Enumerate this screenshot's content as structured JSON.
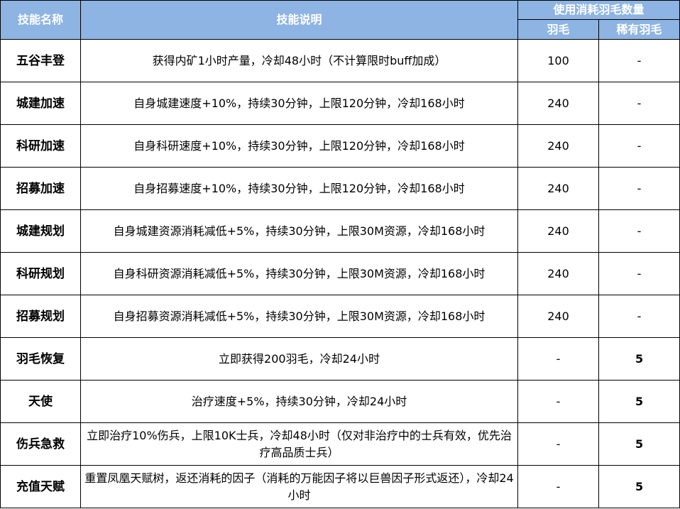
{
  "header": {
    "col_name": "技能名称",
    "col_desc": "技能说明",
    "col_cost_group": "使用消耗羽毛数量",
    "col_feather": "羽毛",
    "col_rare_feather": "稀有羽毛"
  },
  "rows": [
    {
      "name": "五谷丰登",
      "desc": "获得内矿1小时产量，冷却48小时（不计算限时buff加成）",
      "feather": "100",
      "rare": "-"
    },
    {
      "name": "城建加速",
      "desc": "自身城建速度+10%，持续30分钟，上限120分钟，冷却168小时",
      "feather": "240",
      "rare": "-"
    },
    {
      "name": "科研加速",
      "desc": "自身科研速度+10%，持续30分钟，上限120分钟，冷却168小时",
      "feather": "240",
      "rare": "-"
    },
    {
      "name": "招募加速",
      "desc": "自身招募速度+10%，持续30分钟，上限120分钟，冷却168小时",
      "feather": "240",
      "rare": "-"
    },
    {
      "name": "城建规划",
      "desc": "自身城建资源消耗减低+5%，持续30分钟，上限30M资源，冷却168小时",
      "feather": "240",
      "rare": "-"
    },
    {
      "name": "科研规划",
      "desc": "自身科研资源消耗减低+5%，持续30分钟，上限30M资源，冷却168小时",
      "feather": "240",
      "rare": "-"
    },
    {
      "name": "招募规划",
      "desc": "自身招募资源消耗减低+5%，持续30分钟，上限30M资源，冷却168小时",
      "feather": "240",
      "rare": "-"
    },
    {
      "name": "羽毛恢复",
      "desc": "立即获得200羽毛，冷却24小时",
      "feather": "-",
      "rare": "5"
    },
    {
      "name": "天使",
      "desc": "治疗速度+5%，持续30分钟，冷却24小时",
      "feather": "-",
      "rare": "5"
    },
    {
      "name": "伤兵急救",
      "desc": "立即治疗10%伤兵，上限10K士兵，冷却48小时（仅对非治疗中的士兵有效，优先治疗高品质士兵）",
      "feather": "-",
      "rare": "5"
    },
    {
      "name": "充值天赋",
      "desc": "重置凤凰天赋树，返还消耗的因子（消耗的万能因子将以巨兽因子形式返还），冷却24小时",
      "feather": "-",
      "rare": "5"
    }
  ],
  "colors": {
    "header_bg": "#8db4e2",
    "header_text": "#ffffff",
    "border": "#000000"
  }
}
